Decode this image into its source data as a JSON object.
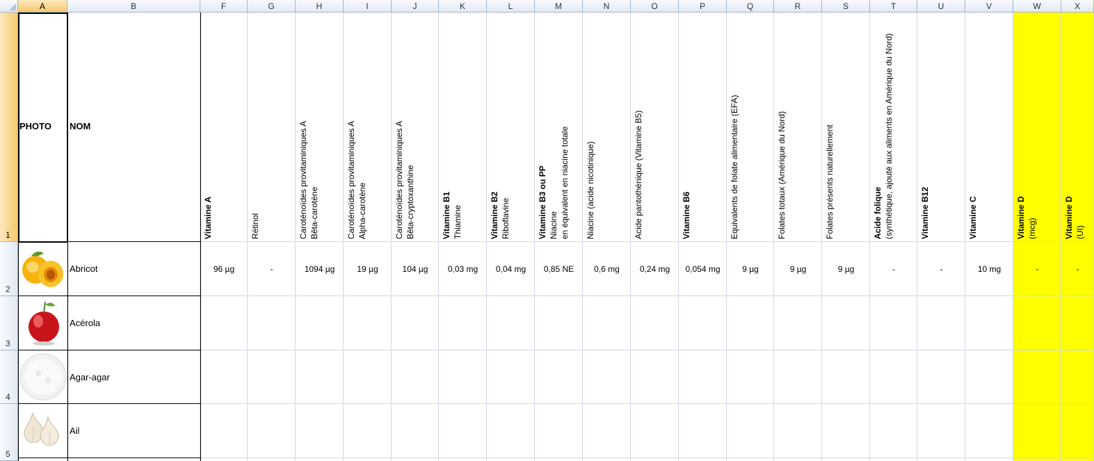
{
  "columns": [
    "A",
    "B",
    "F",
    "G",
    "H",
    "I",
    "J",
    "K",
    "L",
    "M",
    "N",
    "O",
    "P",
    "Q",
    "R",
    "S",
    "T",
    "U",
    "V",
    "W",
    "X"
  ],
  "rows": [
    "1",
    "2",
    "3",
    "4",
    "5"
  ],
  "header": {
    "photo": "PHOTO",
    "nom": "NOM",
    "F": {
      "bold": "Vitamine A",
      "sub": ""
    },
    "G": {
      "bold": "",
      "sub": "Rétinol"
    },
    "H": {
      "bold": "",
      "sub": "Caroténoïdes provitaminiques A",
      "sub2": "Bêta-carotène"
    },
    "I": {
      "bold": "",
      "sub": "Caroténoïdes provitaminiques A",
      "sub2": "Alpha-carotène"
    },
    "J": {
      "bold": "",
      "sub": "Caroténoïdes provitaminiques A",
      "sub2": "Bêta-cryptoxanthine"
    },
    "K": {
      "bold": "Vitamine B1",
      "sub": "Thiamine"
    },
    "L": {
      "bold": "Vitamine B2",
      "sub": "Riboflavine"
    },
    "M": {
      "bold": "Vitamine B3 ou PP",
      "sub": "Niacine",
      "sub2": "en équivalent en niacine totale"
    },
    "N": {
      "bold": "",
      "sub": "Niacine (acide nicotinique)"
    },
    "O": {
      "bold": "",
      "sub": "Acide pantothénique (Vitamine B5)"
    },
    "P": {
      "bold": "Vitamine B6",
      "sub": ""
    },
    "Q": {
      "bold": "",
      "sub": "Equivalents de folate alimentaire (EFA)"
    },
    "R": {
      "bold": "",
      "sub": "Folates totaux (Amérique du Nord)"
    },
    "S": {
      "bold": "",
      "sub": "Folates présents naturellement"
    },
    "T": {
      "bold": "Acide folique",
      "sub": "(synthétique, ajouté aux aliments en Amérique du Nord)"
    },
    "U": {
      "bold": "Vitamine B12",
      "sub": ""
    },
    "V": {
      "bold": "Vitamine C",
      "sub": ""
    },
    "W": {
      "bold": "Vitamine D",
      "sub": "(mcg)"
    },
    "X": {
      "bold": "Vitamine D",
      "sub": "(UI)"
    }
  },
  "items": [
    {
      "name": "Abricot",
      "photo_icon": "apricot-photo",
      "values": [
        "96 µg",
        "-",
        "1094 µg",
        "19 µg",
        "104 µg",
        "0,03 mg",
        "0,04 mg",
        "0,85 NE",
        "0,6 mg",
        "0,24 mg",
        "0,054 mg",
        "9 µg",
        "9 µg",
        "9 µg",
        "-",
        "-",
        "10 mg",
        "-",
        "-"
      ]
    },
    {
      "name": "Acérola",
      "photo_icon": "acerola-photo",
      "values": []
    },
    {
      "name": "Agar-agar",
      "photo_icon": "agar-agar-photo",
      "values": []
    },
    {
      "name": "Ail",
      "photo_icon": "garlic-photo",
      "values": []
    }
  ],
  "colors": {
    "highlight": "#ffff00",
    "selected_header": "#f6c86b",
    "gridline": "#d0d7e5"
  }
}
